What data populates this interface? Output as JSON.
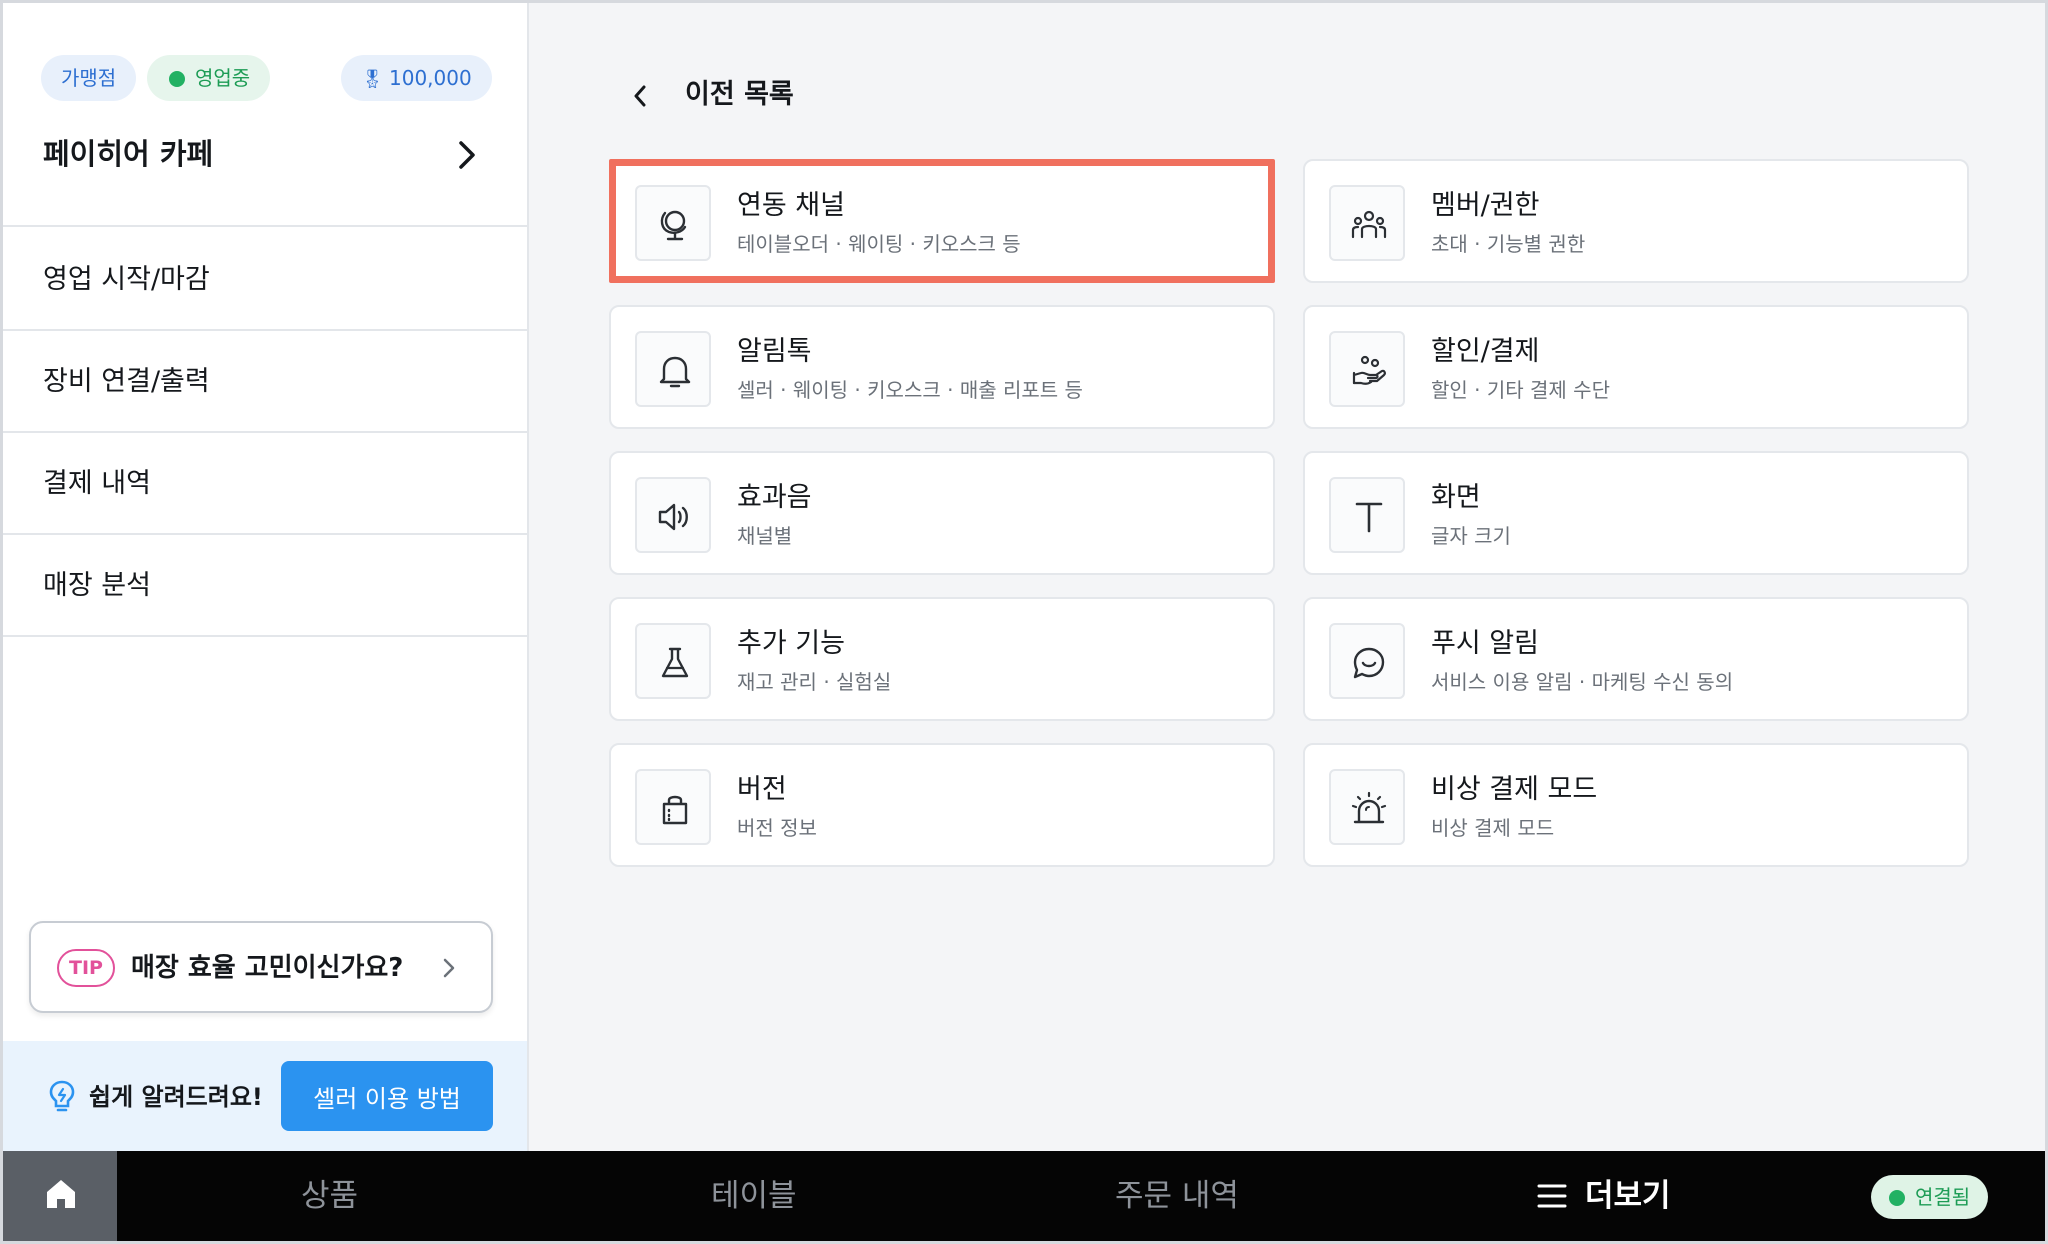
{
  "sidebar": {
    "badges": {
      "franchise": "가맹점",
      "status": "영업중",
      "points": "100,000"
    },
    "store_name": "페이히어 카페",
    "menu": [
      {
        "label": "영업 시작/마감"
      },
      {
        "label": "장비 연결/출력"
      },
      {
        "label": "결제 내역"
      },
      {
        "label": "매장 분석"
      }
    ],
    "tip": {
      "pill": "TIP",
      "text": "매장 효율 고민이신가요?"
    },
    "help": {
      "text": "쉽게 알려드려요!",
      "button": "셀러 이용 방법"
    }
  },
  "main": {
    "back_label": "이전 목록",
    "cards": [
      {
        "title": "연동 채널",
        "subtitle": "테이블오더 · 웨이팅 · 키오스크 등",
        "icon": "globe-icon"
      },
      {
        "title": "멤버/권한",
        "subtitle": "초대 · 기능별 권한",
        "icon": "members-icon"
      },
      {
        "title": "알림톡",
        "subtitle": "셀러 · 웨이팅 · 키오스크 · 매출 리포트 등",
        "icon": "bell-icon"
      },
      {
        "title": "할인/결제",
        "subtitle": "할인 · 기타 결제 수단",
        "icon": "hand-coins-icon"
      },
      {
        "title": "효과음",
        "subtitle": "채널별",
        "icon": "speaker-icon"
      },
      {
        "title": "화면",
        "subtitle": "글자 크기",
        "icon": "text-icon"
      },
      {
        "title": "추가 기능",
        "subtitle": "재고 관리 · 실험실",
        "icon": "flask-icon"
      },
      {
        "title": "푸시 알림",
        "subtitle": "서비스 이용 알림 · 마케팅 수신 동의",
        "icon": "chat-smile-icon"
      },
      {
        "title": "버전",
        "subtitle": "버전 정보",
        "icon": "bag-icon"
      },
      {
        "title": "비상 결제 모드",
        "subtitle": "비상 결제 모드",
        "icon": "siren-icon"
      }
    ]
  },
  "bottom_nav": {
    "tabs": [
      "상품",
      "테이블",
      "주문 내역",
      "더보기"
    ],
    "active": "더보기",
    "connection": "연결됨"
  },
  "colors": {
    "accent_blue": "#2b93f0",
    "highlight": "#f0705e",
    "status_green": "#22b163",
    "tip_pink": "#e2519a"
  }
}
